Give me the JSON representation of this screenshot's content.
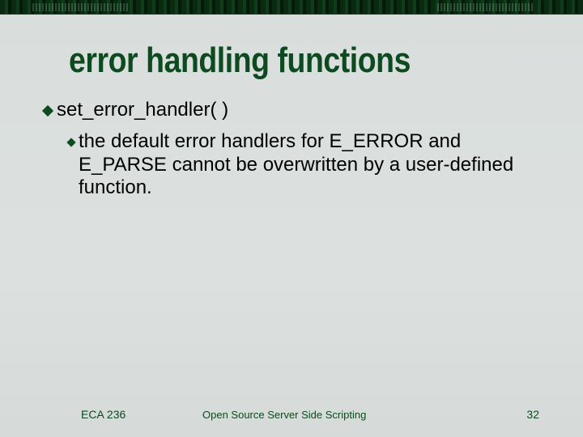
{
  "title": "error handling functions",
  "bullets": {
    "level1": "set_error_handler( )",
    "level2": "the default error handlers for E_ERROR and E_PARSE cannot be overwritten by a user-defined function."
  },
  "footer": {
    "left": "ECA 236",
    "center": "Open Source Server Side Scripting",
    "right": "32"
  }
}
